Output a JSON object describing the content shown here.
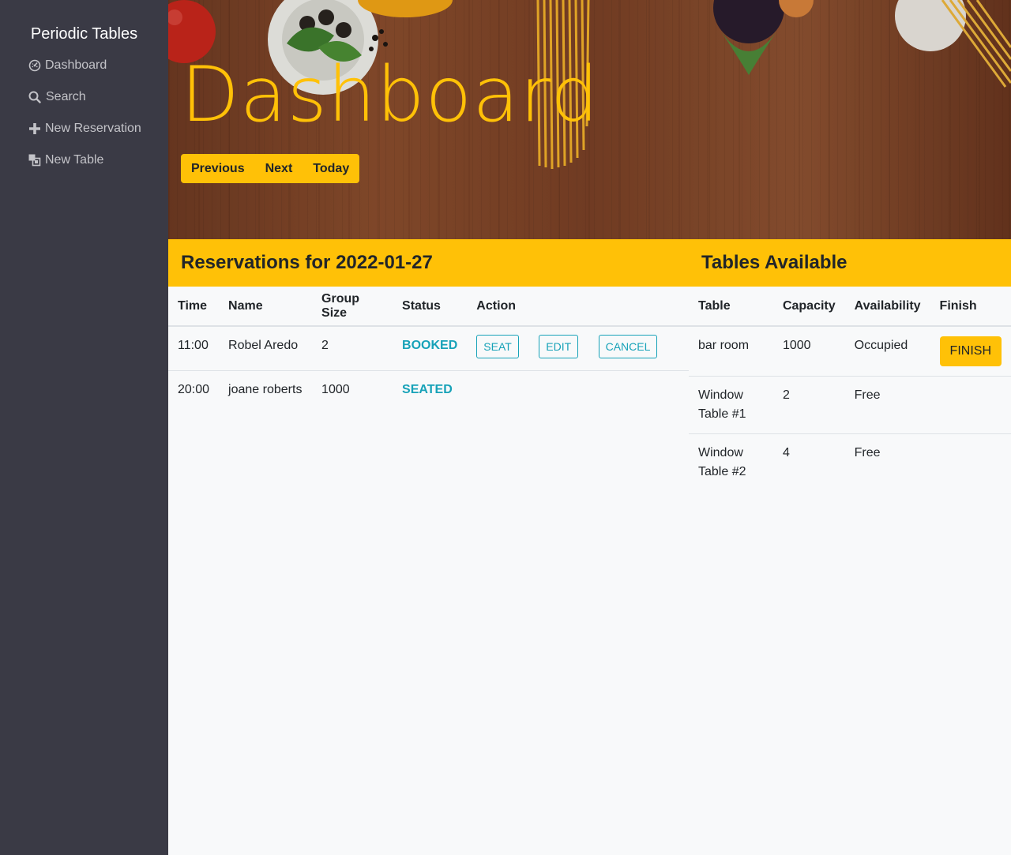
{
  "sidebar": {
    "brand": "Periodic Tables",
    "items": [
      {
        "label": "Dashboard",
        "icon": "dashboard-icon"
      },
      {
        "label": "Search",
        "icon": "search-icon"
      },
      {
        "label": "New Reservation",
        "icon": "plus-icon"
      },
      {
        "label": "New Table",
        "icon": "table-icon"
      }
    ]
  },
  "hero": {
    "title": "Dashboard",
    "buttons": {
      "previous": "Previous",
      "next": "Next",
      "today": "Today"
    }
  },
  "reservations": {
    "heading": "Reservations for 2022-01-27",
    "columns": [
      "Time",
      "Name",
      "Group Size",
      "Status",
      "Action"
    ],
    "rows": [
      {
        "time": "11:00",
        "name": "Robel Aredo",
        "group_size": "2",
        "status": "BOOKED",
        "actions": {
          "seat": "SEAT",
          "edit": "EDIT",
          "cancel": "CANCEL"
        }
      },
      {
        "time": "20:00",
        "name": "joane roberts",
        "group_size": "1000",
        "status": "SEATED"
      }
    ]
  },
  "tables": {
    "heading": "Tables Available",
    "columns": [
      "Table",
      "Capacity",
      "Availability",
      "Finish"
    ],
    "rows": [
      {
        "table": "bar room",
        "capacity": "1000",
        "availability": "Occupied",
        "finish": "FINISH"
      },
      {
        "table": "Window Table #1",
        "capacity": "2",
        "availability": "Free"
      },
      {
        "table": "Window Table #2",
        "capacity": "4",
        "availability": "Free"
      }
    ]
  },
  "colors": {
    "sidebar_bg": "#3a3a45",
    "accent": "#ffc107",
    "status": "#17a2b8",
    "page_bg": "#f8f9fa"
  }
}
